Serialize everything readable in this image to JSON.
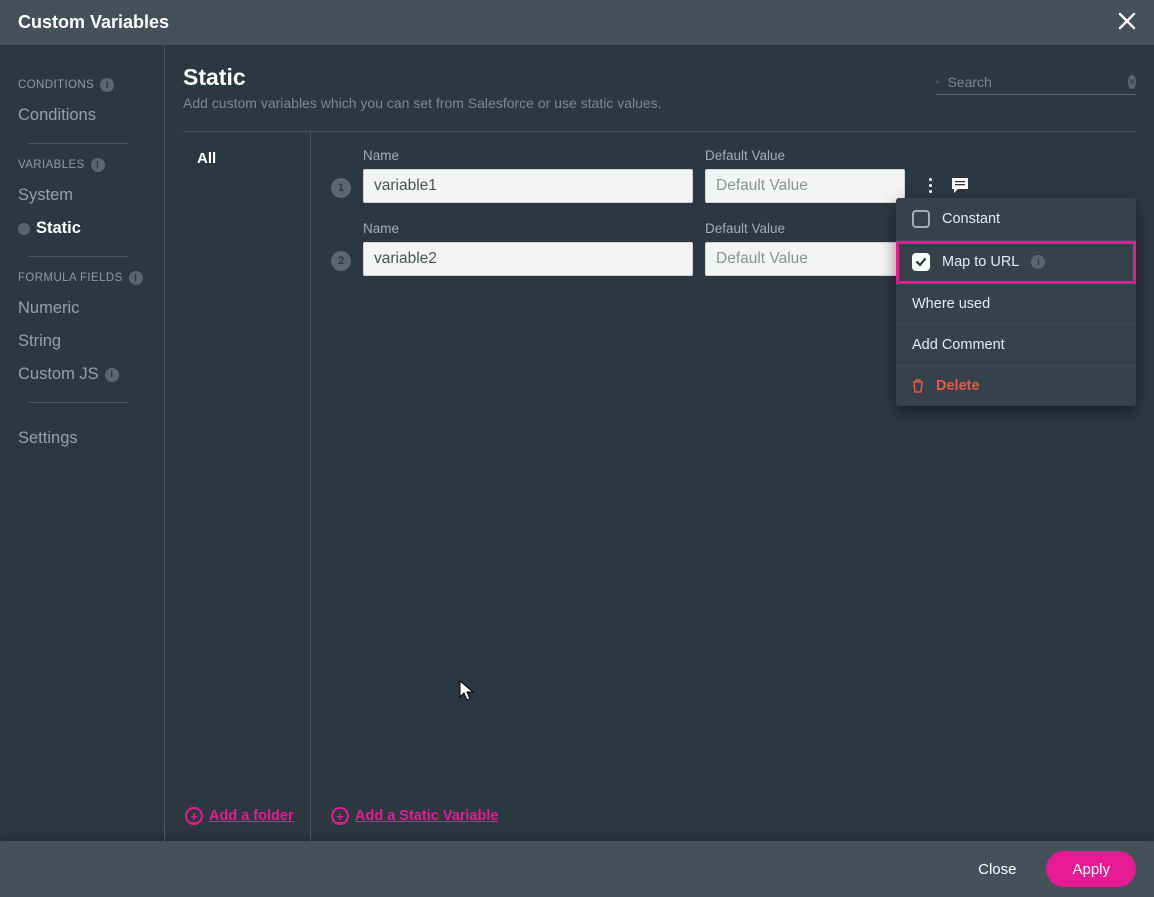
{
  "header": {
    "title": "Custom Variables"
  },
  "sidebar": {
    "conditions_label": "CONDITIONS",
    "conditions_item": "Conditions",
    "variables_label": "VARIABLES",
    "system_item": "System",
    "static_item": "Static",
    "formula_label": "FORMULA FIELDS",
    "numeric_item": "Numeric",
    "string_item": "String",
    "customjs_item": "Custom JS",
    "settings_item": "Settings"
  },
  "page": {
    "title": "Static",
    "subtitle": "Add custom variables which you can set from Salesforce or use static values.",
    "search_placeholder": "Search"
  },
  "folders": {
    "all": "All"
  },
  "labels": {
    "name": "Name",
    "default_value": "Default Value",
    "default_value_ph": "Default Value"
  },
  "variables": [
    {
      "num": "1",
      "name": "variable1",
      "default": ""
    },
    {
      "num": "2",
      "name": "variable2",
      "default": ""
    }
  ],
  "menu": {
    "constant": "Constant",
    "map_to_url": "Map to URL",
    "where_used": "Where used",
    "add_comment": "Add Comment",
    "delete": "Delete"
  },
  "links": {
    "add_folder": "Add a folder",
    "add_variable": "Add a Static Variable"
  },
  "footer": {
    "close": "Close",
    "apply": "Apply"
  }
}
